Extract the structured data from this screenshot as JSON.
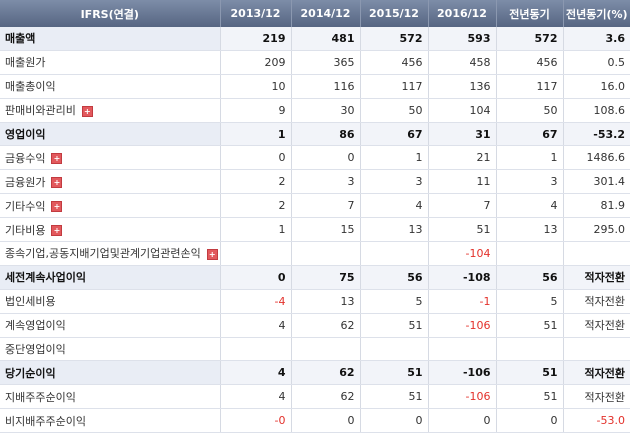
{
  "table": {
    "headers": [
      "IFRS(연결)",
      "2013/12",
      "2014/12",
      "2015/12",
      "2016/12",
      "전년동기",
      "전년동기(%)"
    ],
    "rows": [
      {
        "label": "매출액",
        "values": [
          "219",
          "481",
          "572",
          "593",
          "572",
          "3.6"
        ],
        "bold": true,
        "expand": false
      },
      {
        "label": "매출원가",
        "values": [
          "209",
          "365",
          "456",
          "458",
          "456",
          "0.5"
        ],
        "bold": false,
        "expand": false
      },
      {
        "label": "매출총이익",
        "values": [
          "10",
          "116",
          "117",
          "136",
          "117",
          "16.0"
        ],
        "bold": false,
        "expand": false
      },
      {
        "label": "판매비와관리비",
        "values": [
          "9",
          "30",
          "50",
          "104",
          "50",
          "108.6"
        ],
        "bold": false,
        "expand": true
      },
      {
        "label": "영업이익",
        "values": [
          "1",
          "86",
          "67",
          "31",
          "67",
          "-53.2"
        ],
        "bold": true,
        "expand": false
      },
      {
        "label": "금융수익",
        "values": [
          "0",
          "0",
          "1",
          "21",
          "1",
          "1486.6"
        ],
        "bold": false,
        "expand": true
      },
      {
        "label": "금융원가",
        "values": [
          "2",
          "3",
          "3",
          "11",
          "3",
          "301.4"
        ],
        "bold": false,
        "expand": true
      },
      {
        "label": "기타수익",
        "values": [
          "2",
          "7",
          "4",
          "7",
          "4",
          "81.9"
        ],
        "bold": false,
        "expand": true
      },
      {
        "label": "기타비용",
        "values": [
          "1",
          "15",
          "13",
          "51",
          "13",
          "295.0"
        ],
        "bold": false,
        "expand": true
      },
      {
        "label": "종속기업,공동지배기업및관계기업관련손익",
        "values": [
          "",
          "",
          "",
          "-104",
          "",
          ""
        ],
        "bold": false,
        "expand": true
      },
      {
        "label": "세전계속사업이익",
        "values": [
          "0",
          "75",
          "56",
          "-108",
          "56",
          "적자전환"
        ],
        "bold": true,
        "expand": false
      },
      {
        "label": "법인세비용",
        "values": [
          "-4",
          "13",
          "5",
          "-1",
          "5",
          "적자전환"
        ],
        "bold": false,
        "expand": false
      },
      {
        "label": "계속영업이익",
        "values": [
          "4",
          "62",
          "51",
          "-106",
          "51",
          "적자전환"
        ],
        "bold": false,
        "expand": false
      },
      {
        "label": "중단영업이익",
        "values": [
          "",
          "",
          "",
          "",
          "",
          ""
        ],
        "bold": false,
        "expand": false
      },
      {
        "label": "당기순이익",
        "values": [
          "4",
          "62",
          "51",
          "-106",
          "51",
          "적자전환"
        ],
        "bold": true,
        "expand": false
      },
      {
        "label": "지배주주순이익",
        "values": [
          "4",
          "62",
          "51",
          "-106",
          "51",
          "적자전환"
        ],
        "bold": false,
        "expand": false,
        "indent": true
      },
      {
        "label": "비지배주주순이익",
        "values": [
          "-0",
          "0",
          "0",
          "0",
          "0",
          "-53.0"
        ],
        "bold": false,
        "expand": false,
        "indent": true
      }
    ],
    "expand_symbol": "+",
    "colors": {
      "header_bg": "#62708c",
      "negative": "#e3312b",
      "bold_row_bg": "#e9edf5",
      "expand_button": "#e2595d"
    }
  }
}
